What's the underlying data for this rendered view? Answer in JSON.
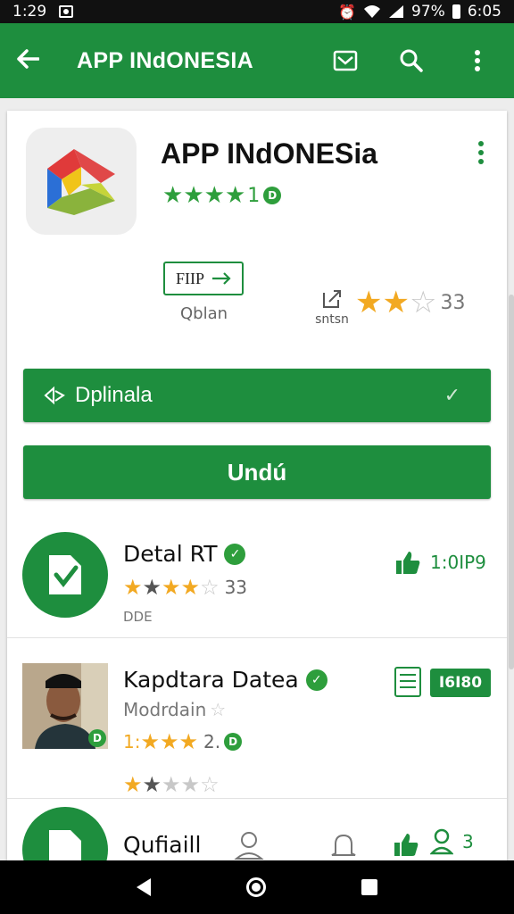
{
  "status_bar": {
    "time": "1:29",
    "battery": "97%",
    "clock": "6:05"
  },
  "app_bar": {
    "title": "APP INdONESIA"
  },
  "header": {
    "app_name": "APP INdONESia",
    "rating_count": "1",
    "rating_badge": "D"
  },
  "secondary": {
    "outline_button_label": "FIIP",
    "outline_caption": "Qblan",
    "share_caption": "sntsn",
    "rating_count": "33"
  },
  "buttons": {
    "download_label": "Dplinala",
    "undu_label": "Undú"
  },
  "list": [
    {
      "title": "Detal RT",
      "rating_count": "33",
      "sub": "DDE",
      "meta": "1:0IP9"
    },
    {
      "title": "Kapdtara Datea",
      "subtitle": "Modrdain",
      "inline_rating_prefix": "1:",
      "inline_rating_count": "2.",
      "inline_badge": "D",
      "badge": "I6I80"
    },
    {
      "title": "Qufiaill",
      "meta_count": "3"
    }
  ],
  "colors": {
    "primary": "#1e8e3e",
    "star": "#f2a922"
  },
  "icons": [
    "back-arrow-icon",
    "mail-icon",
    "search-icon",
    "more-vert-icon",
    "share-icon",
    "thumbs-up-icon",
    "verified-icon",
    "document-icon",
    "user-icon",
    "bell-icon"
  ]
}
